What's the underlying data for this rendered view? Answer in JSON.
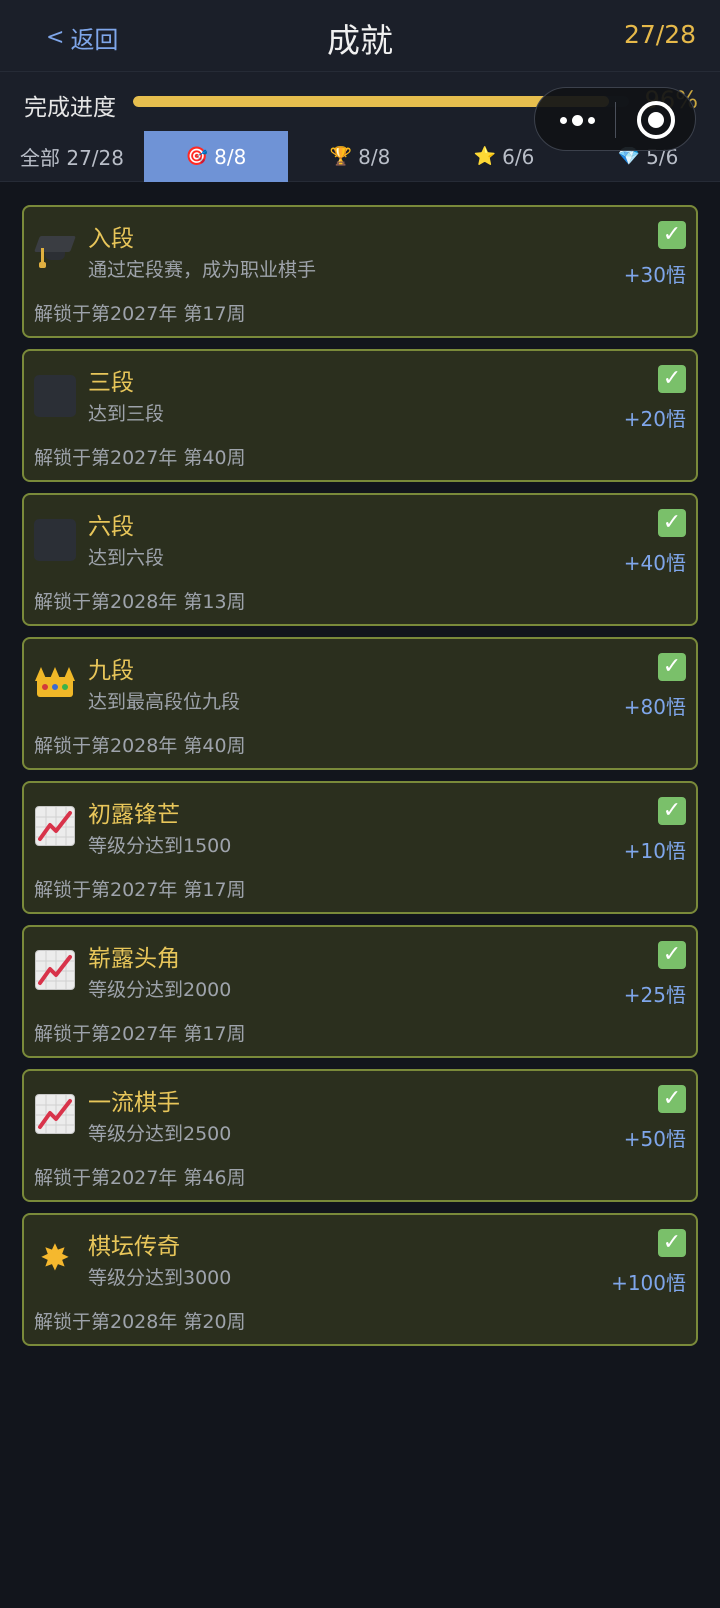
{
  "header": {
    "back_label": "返回",
    "title": "成就",
    "count": "27/28"
  },
  "progress": {
    "label": "完成进度",
    "percent_text": "96%",
    "fraction": 0.96
  },
  "tabs": [
    {
      "icon": "",
      "label": "全部 27/28",
      "active": false
    },
    {
      "icon": "🎯",
      "label": "8/8",
      "active": true
    },
    {
      "icon": "🏆",
      "label": "8/8",
      "active": false
    },
    {
      "icon": "⭐",
      "label": "6/6",
      "active": false
    },
    {
      "icon": "💎",
      "label": "5/6",
      "active": false
    }
  ],
  "achievements": [
    {
      "icon": "graduation-cap-icon",
      "title": "入段",
      "desc": "通过定段赛，成为职业棋手",
      "unlock": "解锁于第2027年 第17周",
      "reward": "+30悟"
    },
    {
      "icon": "blank-icon",
      "title": "三段",
      "desc": "达到三段",
      "unlock": "解锁于第2027年 第40周",
      "reward": "+20悟"
    },
    {
      "icon": "blank-icon",
      "title": "六段",
      "desc": "达到六段",
      "unlock": "解锁于第2028年 第13周",
      "reward": "+40悟"
    },
    {
      "icon": "crown-icon",
      "title": "九段",
      "desc": "达到最高段位九段",
      "unlock": "解锁于第2028年 第40周",
      "reward": "+80悟"
    },
    {
      "icon": "chart-up-icon",
      "title": "初露锋芒",
      "desc": "等级分达到1500",
      "unlock": "解锁于第2027年 第17周",
      "reward": "+10悟"
    },
    {
      "icon": "chart-up-icon",
      "title": "崭露头角",
      "desc": "等级分达到2000",
      "unlock": "解锁于第2027年 第17周",
      "reward": "+25悟"
    },
    {
      "icon": "chart-up-icon",
      "title": "一流棋手",
      "desc": "等级分达到2500",
      "unlock": "解锁于第2027年 第46周",
      "reward": "+50悟"
    },
    {
      "icon": "glowing-star-icon",
      "title": "棋坛传奇",
      "desc": "等级分达到3000",
      "unlock": "解锁于第2028年 第20周",
      "reward": "+100悟"
    }
  ],
  "colors": {
    "accent_blue": "#7fa6ea",
    "gold": "#e6be4e",
    "card_bg": "#2b2f1e",
    "card_border": "#7a8a3a",
    "check_green": "#7ac06a"
  }
}
